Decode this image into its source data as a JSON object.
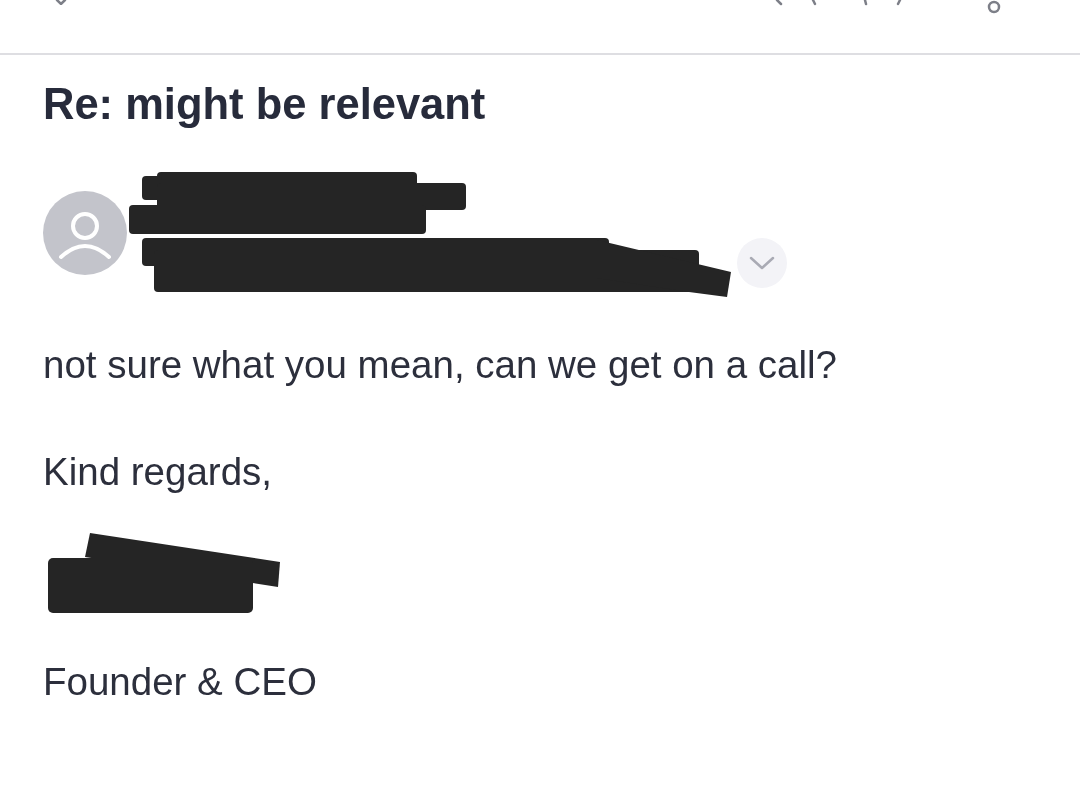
{
  "subject": "Re: might be relevant",
  "sender": {
    "redacted": true,
    "expanded": false
  },
  "message": [
    {
      "kind": "text",
      "text": "not sure what you mean, can we get on a call?"
    },
    {
      "kind": "text",
      "text": "Kind regards,"
    },
    {
      "kind": "redaction"
    },
    {
      "kind": "text",
      "text": "Founder & CEO"
    }
  ]
}
